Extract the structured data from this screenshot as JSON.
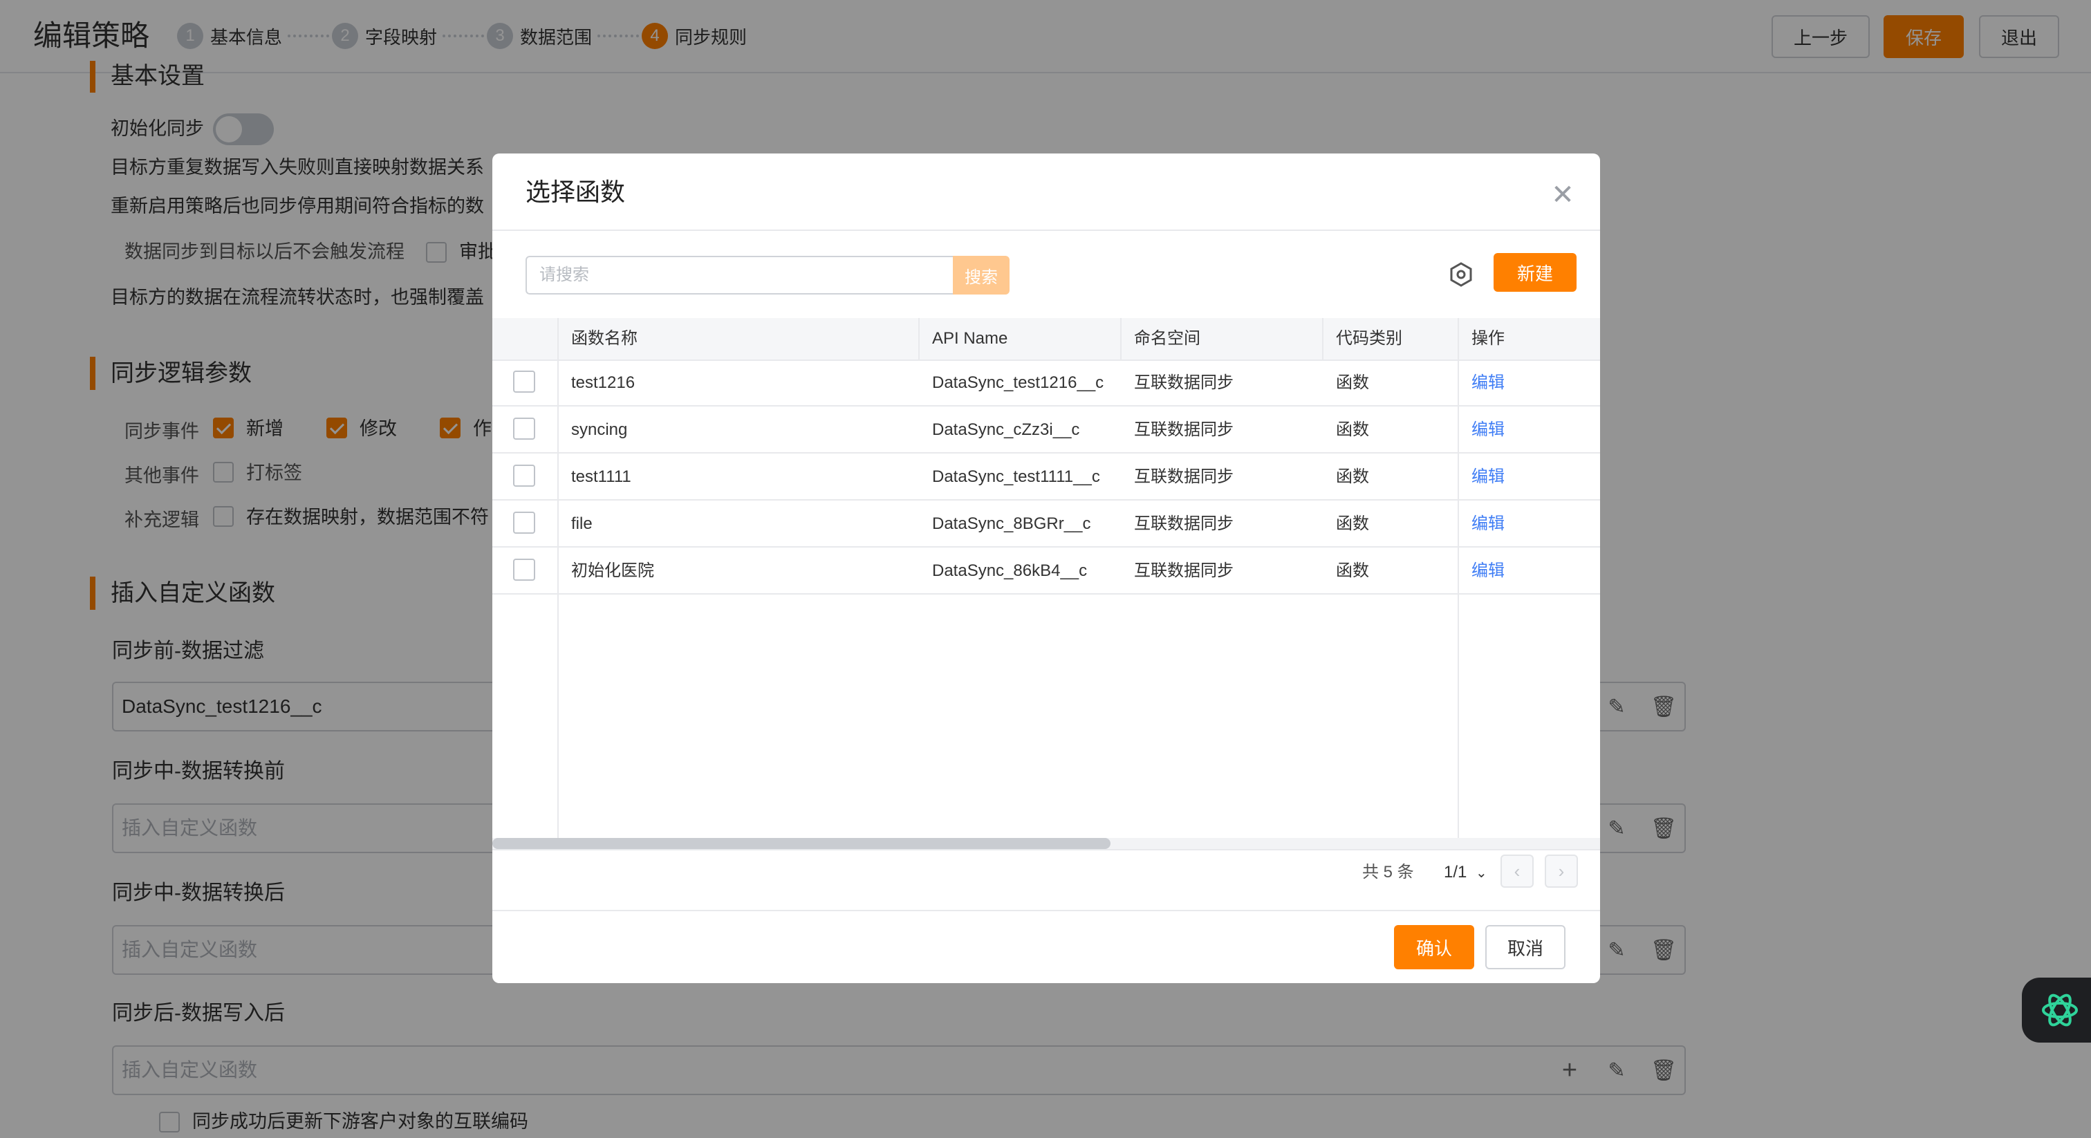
{
  "header": {
    "title": "编辑策略",
    "steps": [
      {
        "num": "1",
        "label": "基本信息"
      },
      {
        "num": "2",
        "label": "字段映射"
      },
      {
        "num": "3",
        "label": "数据范围"
      },
      {
        "num": "4",
        "label": "同步规则"
      }
    ],
    "active_step": 4,
    "prev_label": "上一步",
    "save_label": "保存",
    "exit_label": "退出"
  },
  "page": {
    "basic_section_title": "基本设置",
    "init_sync_label": "初始化同步",
    "line_retry": "目标方重复数据写入失败则直接映射数据关系",
    "line_resync": "重新启用策略后也同步停用期间符合指标的数",
    "no_trigger_label": "数据同步到目标以后不会触发流程",
    "approval_label": "审批",
    "force_overwrite": "目标方的数据在流程流转状态时，也强制覆盖",
    "sync_logic_title": "同步逻辑参数",
    "sync_event_label": "同步事件",
    "event_add": "新增",
    "event_edit": "修改",
    "event_third": "作",
    "other_event_label": "其他事件",
    "tag_label": "打标签",
    "extra_logic_label": "补充逻辑",
    "extra_logic_text": "存在数据映射，数据范围不符",
    "custom_fn_title": "插入自定义函数",
    "pre_filter_label": "同步前-数据过滤",
    "pre_filter_value": "DataSync_test1216__c",
    "before_convert_label": "同步中-数据转换前",
    "after_convert_label": "同步中-数据转换后",
    "after_write_label": "同步后-数据写入后",
    "fn_placeholder": "插入自定义函数",
    "update_code_label": "同步成功后更新下游客户对象的互联编码"
  },
  "modal": {
    "title": "选择函数",
    "search_placeholder": "请搜索",
    "search_button": "搜索",
    "new_button": "新建",
    "columns": [
      "函数名称",
      "API Name",
      "命名空间",
      "代码类别",
      "操作"
    ],
    "rows": [
      {
        "name": "test1216",
        "api": "DataSync_test1216__c",
        "ns": "互联数据同步",
        "type": "函数",
        "action": "编辑"
      },
      {
        "name": "syncing",
        "api": "DataSync_cZz3i__c",
        "ns": "互联数据同步",
        "type": "函数",
        "action": "编辑"
      },
      {
        "name": "test1111",
        "api": "DataSync_test1111__c",
        "ns": "互联数据同步",
        "type": "函数",
        "action": "编辑"
      },
      {
        "name": "file",
        "api": "DataSync_8BGRr__c",
        "ns": "互联数据同步",
        "type": "函数",
        "action": "编辑"
      },
      {
        "name": "初始化医院",
        "api": "DataSync_86kB4__c",
        "ns": "互联数据同步",
        "type": "函数",
        "action": "编辑"
      }
    ],
    "total_text": "共 5 条",
    "page_text": "1/1",
    "confirm_label": "确认",
    "cancel_label": "取消"
  },
  "colors": {
    "accent": "#ff8000",
    "link": "#3f7df5"
  }
}
